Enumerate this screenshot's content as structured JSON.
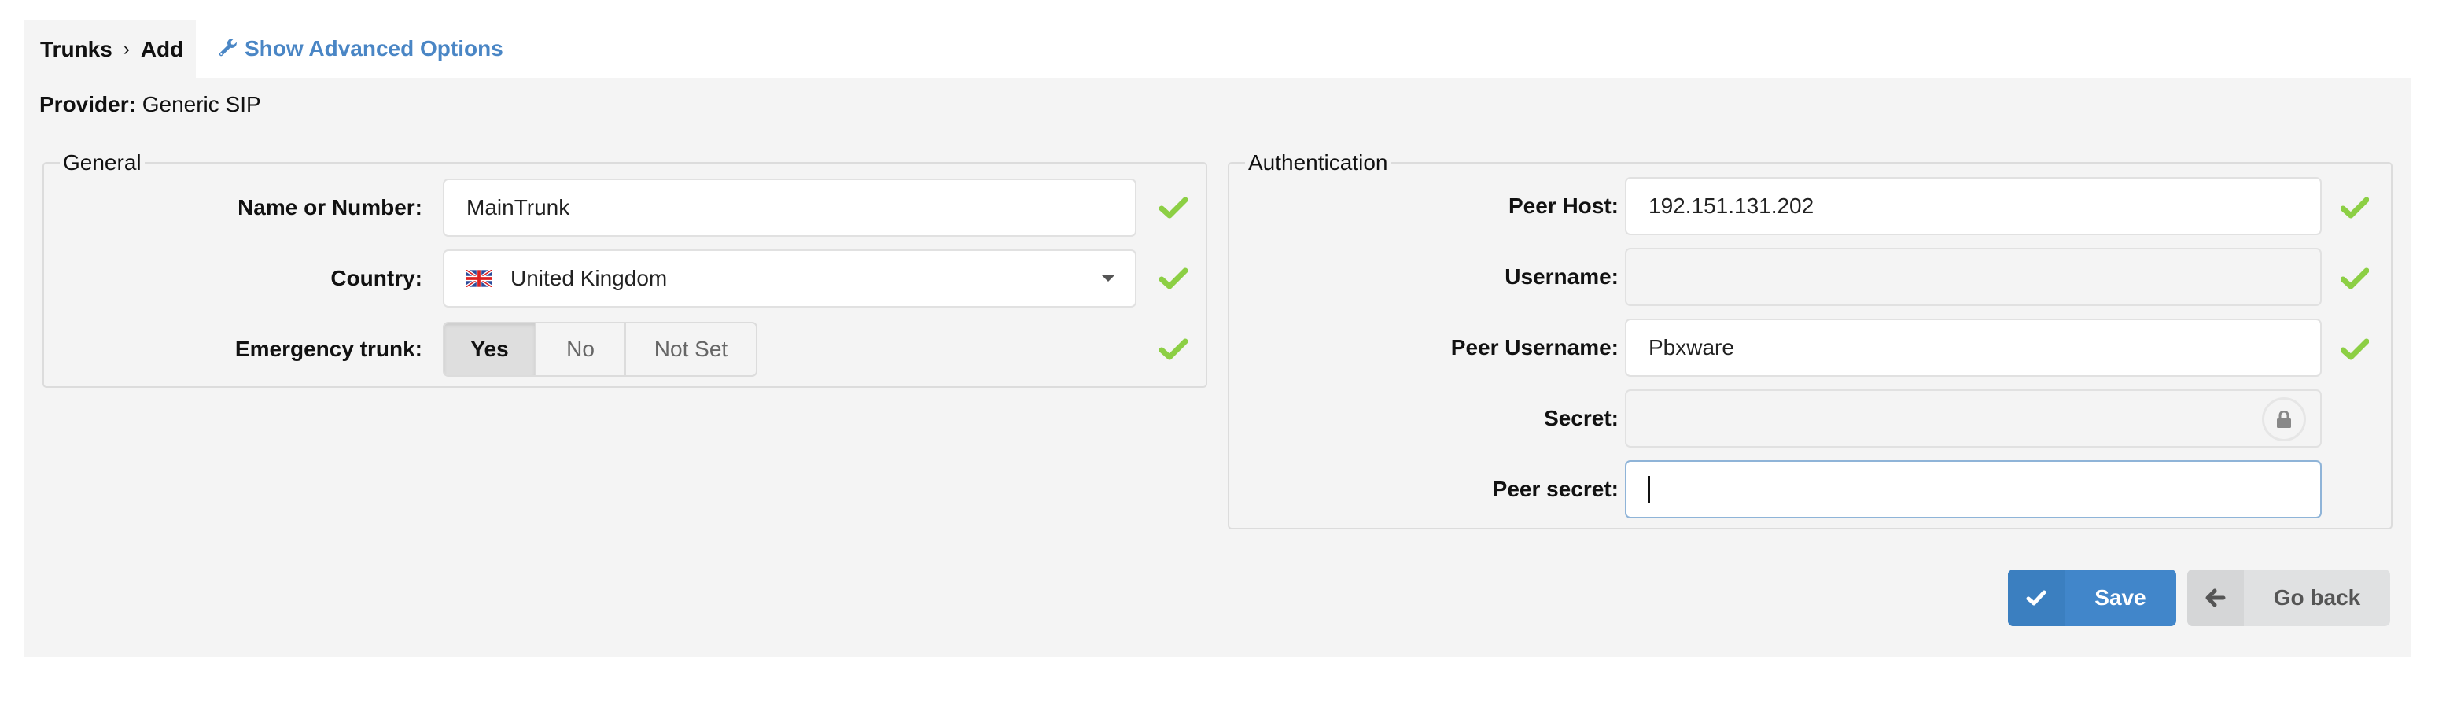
{
  "breadcrumb": {
    "root": "Trunks",
    "separator": "›",
    "current": "Add"
  },
  "advanced_link": {
    "icon": "wrench-icon",
    "label": "Show Advanced Options"
  },
  "provider": {
    "label": "Provider:",
    "value": "Generic SIP"
  },
  "general": {
    "legend": "General",
    "name": {
      "label": "Name or Number:",
      "value": "MainTrunk",
      "valid": true
    },
    "country": {
      "label": "Country:",
      "value": "United Kingdom",
      "flag": "uk-flag-icon",
      "valid": true
    },
    "emergency": {
      "label": "Emergency trunk:",
      "options": [
        "Yes",
        "No",
        "Not Set"
      ],
      "selected": "Yes",
      "valid": true
    }
  },
  "authentication": {
    "legend": "Authentication",
    "peer_host": {
      "label": "Peer Host:",
      "value": "192.151.131.202",
      "valid": true
    },
    "username": {
      "label": "Username:",
      "value": "",
      "disabled": true,
      "valid": true
    },
    "peer_username": {
      "label": "Peer Username:",
      "value": "Pbxware",
      "valid": true
    },
    "secret": {
      "label": "Secret:",
      "value": "",
      "disabled": true,
      "icon": "lock-icon"
    },
    "peer_secret": {
      "label": "Peer secret:",
      "value": "",
      "focused": true
    }
  },
  "actions": {
    "save": {
      "label": "Save",
      "icon": "check-icon"
    },
    "back": {
      "label": "Go back",
      "icon": "arrow-left-icon"
    }
  },
  "colors": {
    "accent": "#4186ca",
    "link": "#4a86c5",
    "valid": "#8ccf44",
    "panel": "#f4f4f4"
  }
}
